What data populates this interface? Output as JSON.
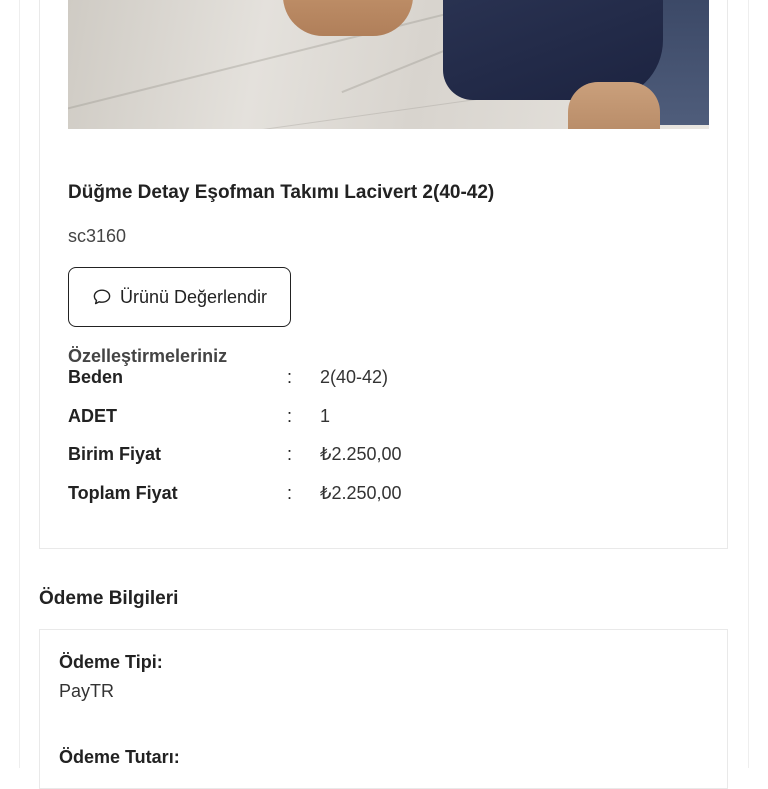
{
  "product": {
    "title": "Düğme Detay Eşofman Takımı Lacivert 2(40-42)",
    "code": "sc3160",
    "review_button_label": "Ürünü Değerlendir",
    "review_icon": "speech-bubble-icon"
  },
  "customizations": {
    "heading": "Özelleştirmeleriniz",
    "rows": [
      {
        "label": "Beden",
        "separator": ":",
        "value": "2(40-42)"
      },
      {
        "label": "ADET",
        "separator": ":",
        "value": "1"
      },
      {
        "label": "Birim Fiyat",
        "separator": ":",
        "value": "₺2.250,00"
      },
      {
        "label": "Toplam Fiyat",
        "separator": ":",
        "value": "₺2.250,00"
      }
    ]
  },
  "payment": {
    "section_title": "Ödeme Bilgileri",
    "type_label": "Ödeme Tipi:",
    "type_value": "PayTR",
    "amount_label": "Ödeme Tutarı:"
  }
}
